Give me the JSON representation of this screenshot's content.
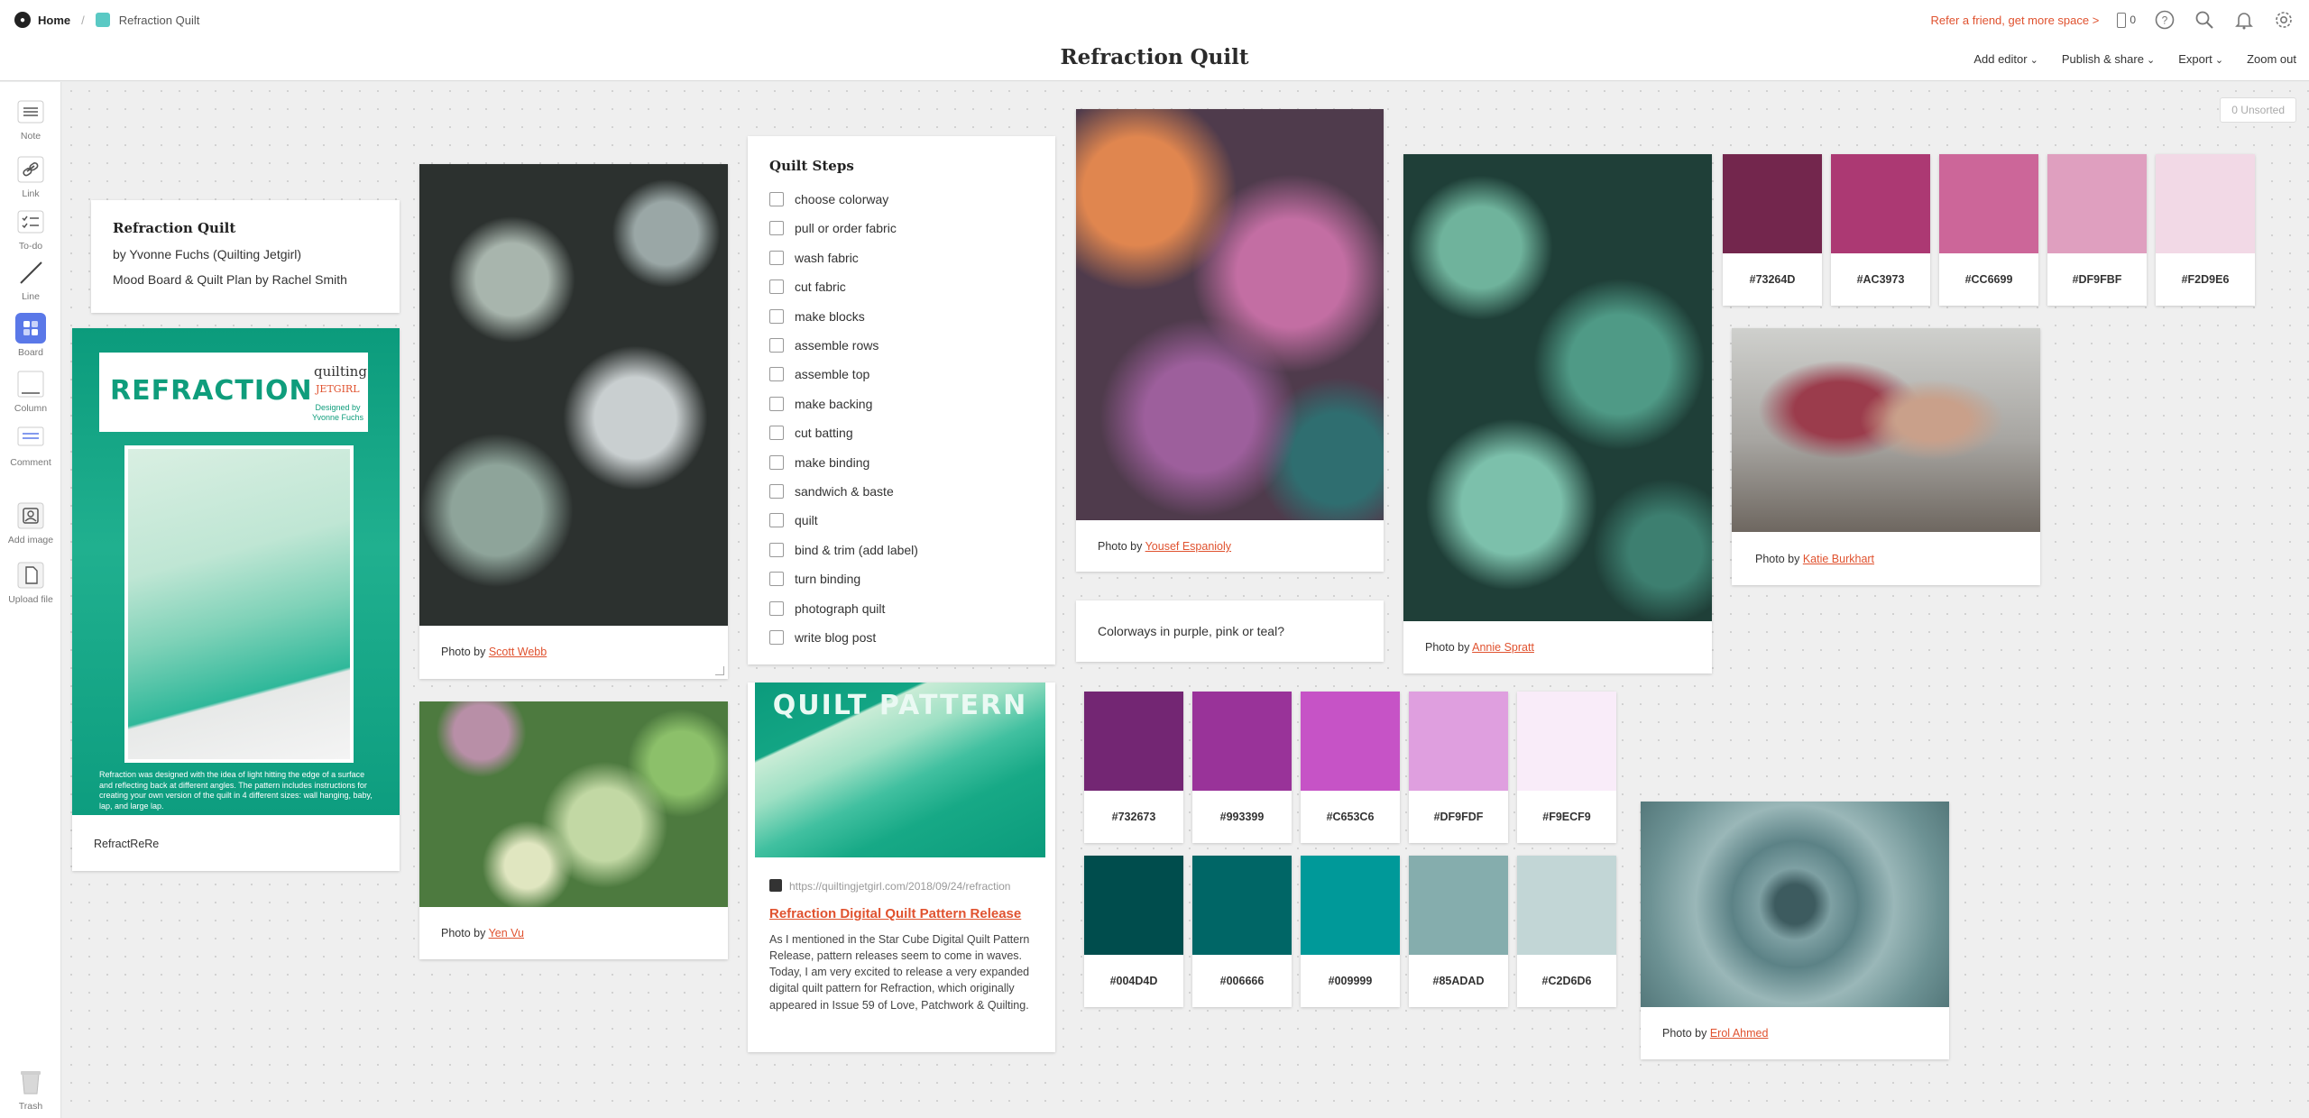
{
  "topbar": {
    "home_label": "Home",
    "board_crumb": "Refraction Quilt",
    "refer_text": "Refer a friend, get more space >",
    "device_count": "0"
  },
  "titlebar": {
    "title": "Refraction Quilt",
    "add_editor": "Add editor",
    "publish_share": "Publish & share",
    "export": "Export",
    "zoom_out": "Zoom out"
  },
  "sidebar": {
    "note": "Note",
    "link": "Link",
    "todo": "To-do",
    "line": "Line",
    "board": "Board",
    "column": "Column",
    "comment": "Comment",
    "add_image": "Add image",
    "upload_file": "Upload file",
    "trash": "Trash"
  },
  "unsorted": "0 Unsorted",
  "intro_note": {
    "title": "Refraction Quilt",
    "line1": "by Yvonne Fuchs (Quilting Jetgirl)",
    "line2": "Mood Board & Quilt Plan by Rachel Smith"
  },
  "refraction_card": {
    "word": "REFRACTION",
    "brand": "quilting",
    "brand2": "JETGIRL",
    "designed": "Designed by",
    "designer": "Yvonne Fuchs",
    "blurb": "Refraction was designed with the idea of light hitting the edge of a surface and reflecting back at different angles. The pattern includes instructions for creating your own version of the quilt in 4 different sizes: wall hanging, baby, lap, and large lap.",
    "caption": "RefractReRe"
  },
  "photos": {
    "scott_prefix": "Photo by ",
    "scott": "Scott Webb",
    "yen_prefix": "Photo by ",
    "yen": "Yen Vu",
    "yousef_prefix": "Photo by ",
    "yousef": "Yousef Espanioly",
    "annie_prefix": "Photo by ",
    "annie": "Annie Spratt",
    "katie_prefix": "Photo by ",
    "katie": "Katie Burkhart",
    "erol_prefix": "Photo by ",
    "erol": "Erol Ahmed"
  },
  "quilt_steps": {
    "title": "Quilt Steps",
    "items": [
      "choose colorway",
      "pull or order fabric",
      "wash fabric",
      "cut fabric",
      "make blocks",
      "assemble rows",
      "assemble top",
      "make backing",
      "cut batting",
      "make binding",
      "sandwich & baste",
      "quilt",
      "bind & trim (add label)",
      "turn binding",
      "photograph quilt",
      "write blog post"
    ]
  },
  "link_card": {
    "image_word": "QUILT PATTERN",
    "url": "https://quiltingjetgirl.com/2018/09/24/refraction",
    "title": "Refraction Digital Quilt Pattern Release",
    "description": "As I mentioned in the Star Cube Digital Quilt Pattern Release, pattern releases seem to come in waves. Today, I am very excited to release a very expanded digital quilt pattern for Refraction, which originally appeared in Issue 59 of Love, Patchwork & Quilting."
  },
  "colorways_note": "Colorways in purple, pink or teal?",
  "swatches_pink": [
    "#73264D",
    "#AC3973",
    "#CC6699",
    "#DF9FBF",
    "#F2D9E6"
  ],
  "swatches_purple": [
    "#732673",
    "#993399",
    "#C653C6",
    "#DF9FDF",
    "#F9ECF9"
  ],
  "swatches_teal": [
    "#004D4D",
    "#006666",
    "#009999",
    "#85ADAD",
    "#C2D6D6"
  ]
}
